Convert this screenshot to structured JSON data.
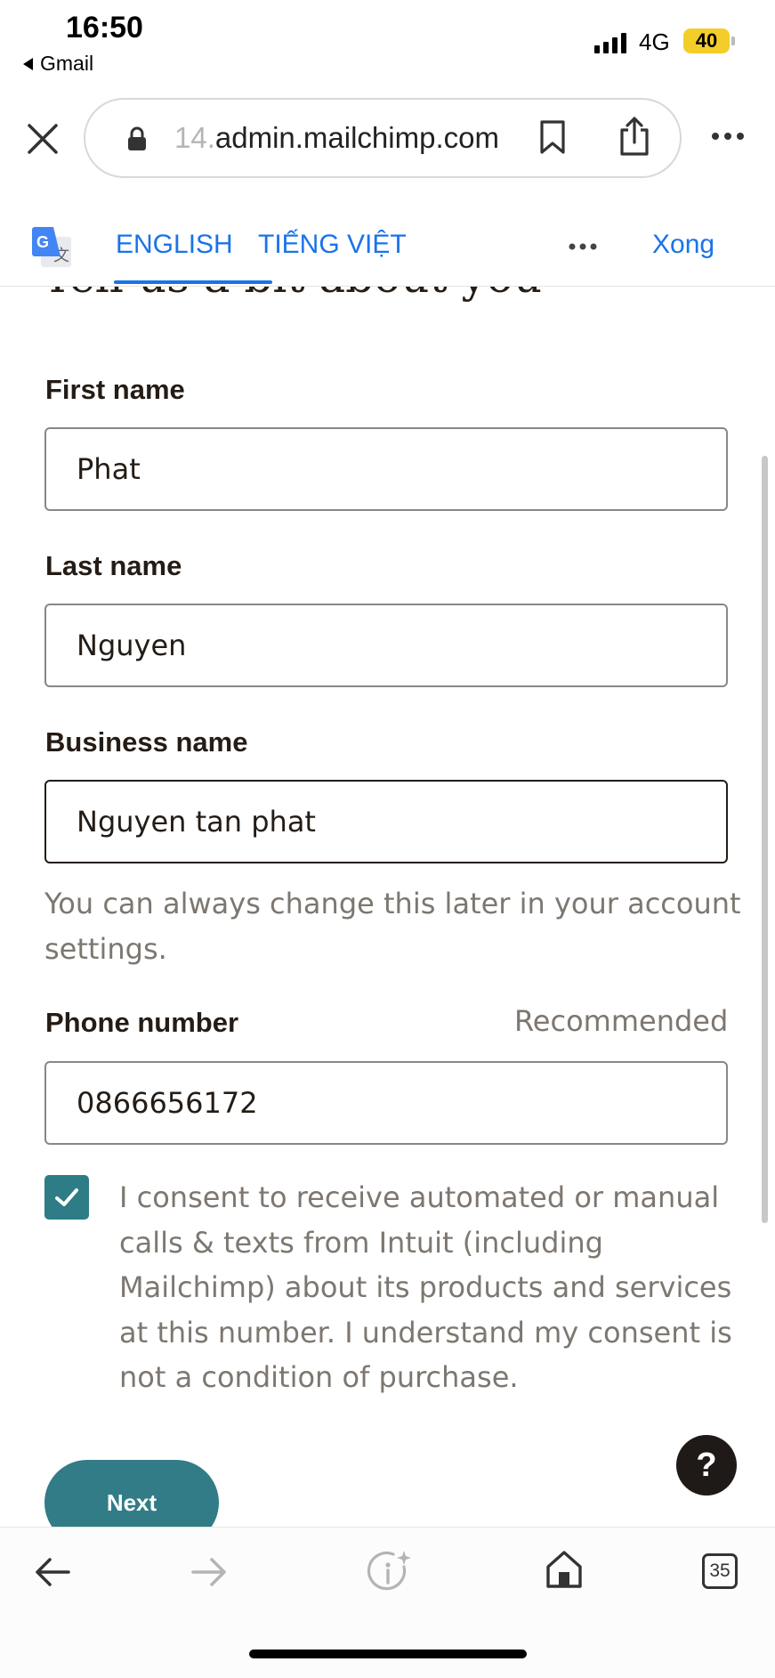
{
  "status_bar": {
    "time": "16:50",
    "back_app": "Gmail",
    "network": "4G",
    "battery": "40"
  },
  "browser": {
    "url_faded": "14.",
    "url_main": "admin.mailchimp.com"
  },
  "translate_bar": {
    "english": "ENGLISH",
    "vietnamese": "TIẾNG VIỆT",
    "done": "Xong",
    "accent_color": "#1a73e8"
  },
  "form": {
    "heading": "Tell us a bit about you",
    "first_name": {
      "label": "First name",
      "value": "Phat"
    },
    "last_name": {
      "label": "Last name",
      "value": "Nguyen"
    },
    "business_name": {
      "label": "Business name",
      "value": "Nguyen tan phat"
    },
    "help_text": "You can always change this later in your account settings.",
    "phone": {
      "label": "Phone number",
      "hint": "Recommended",
      "value": "0866656172"
    },
    "consent": {
      "checked": true,
      "text": "I consent to receive automated or manual calls & texts from Intuit (including Mailchimp) about its products and services at this number. I understand my consent is not a condition of purchase."
    },
    "next_label": "Next",
    "help_button_label": "?",
    "brand_color": "#317c86"
  },
  "toolbar": {
    "tab_count": "35"
  }
}
